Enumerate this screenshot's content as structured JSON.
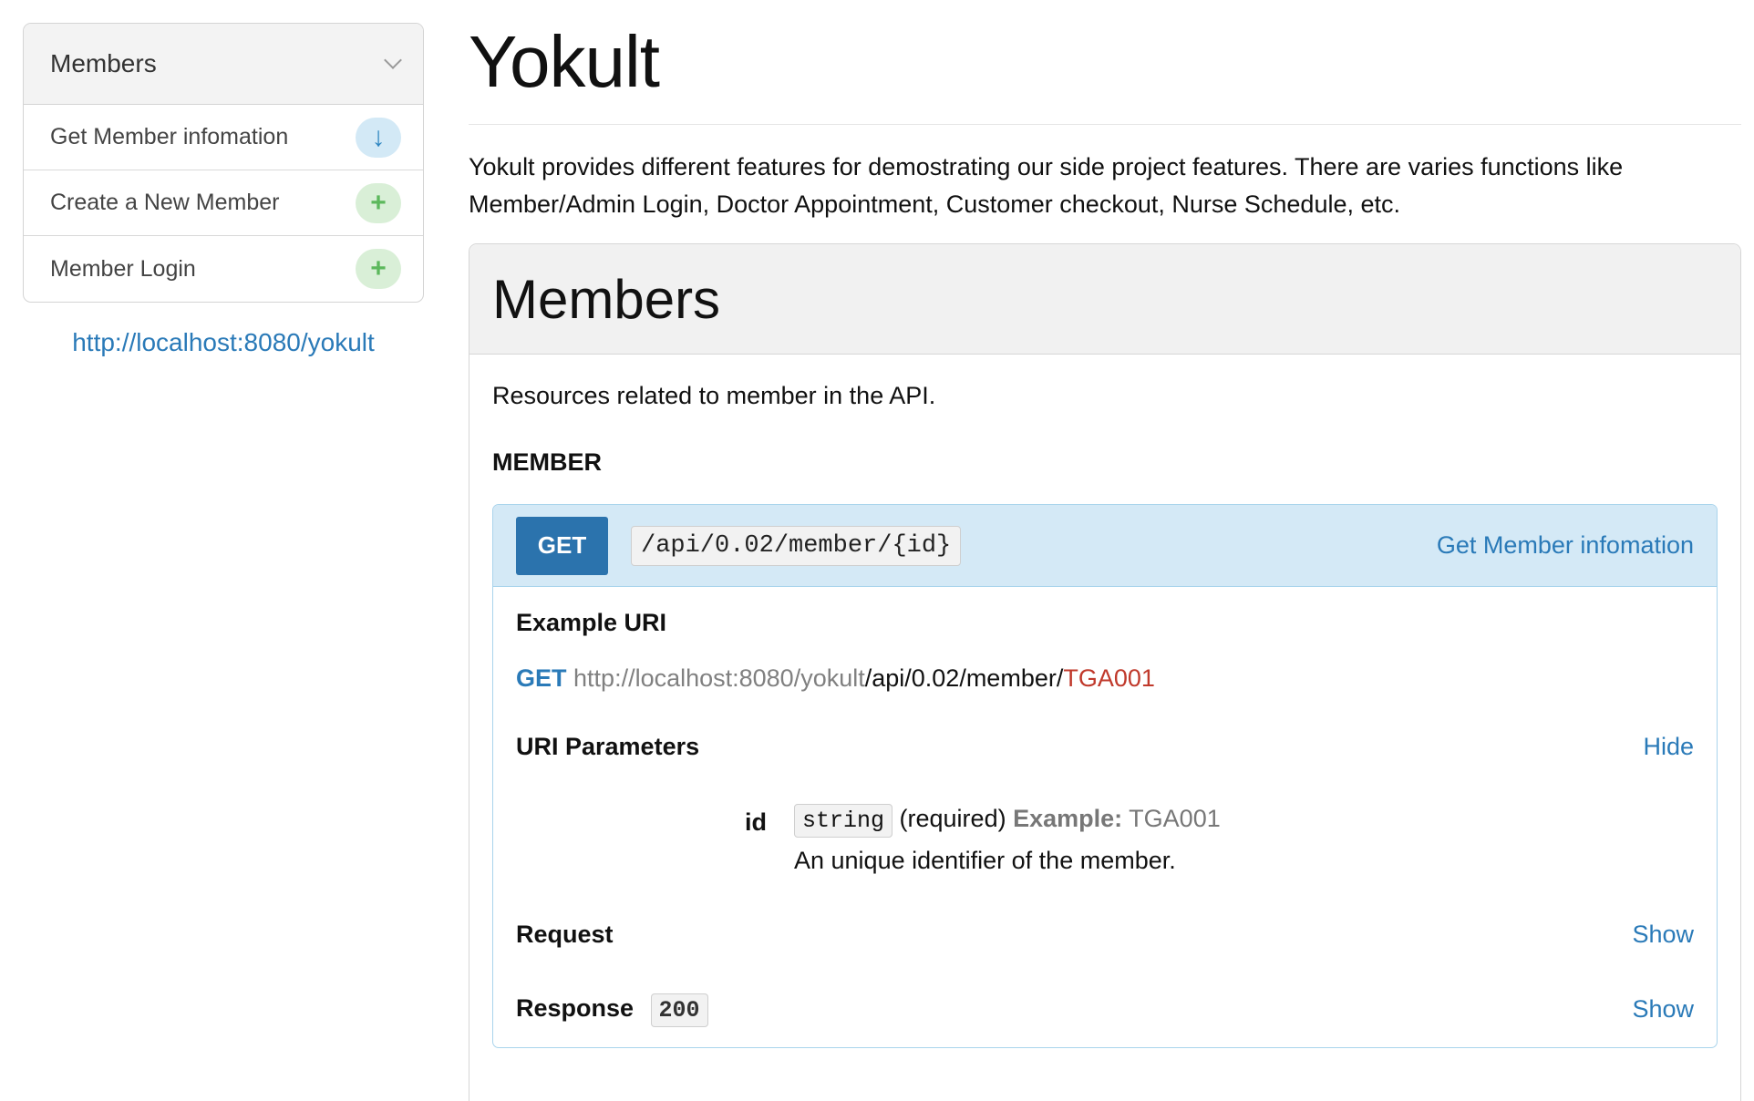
{
  "sidebar": {
    "heading": "Members",
    "items": [
      {
        "label": "Get Member infomation",
        "badge": "↓"
      },
      {
        "label": "Create a New Member",
        "badge": "+"
      },
      {
        "label": "Member Login",
        "badge": "+"
      }
    ],
    "host_link": "http://localhost:8080/yokult"
  },
  "page": {
    "title": "Yokult",
    "intro": "Yokult provides different features for demostrating our side project features. There are varies functions like Member/Admin Login, Doctor Appointment, Customer checkout, Nurse Schedule, etc."
  },
  "section": {
    "title": "Members",
    "description": "Resources related to member in the API.",
    "group_label": "MEMBER"
  },
  "resource": {
    "method": "GET",
    "uri_template": "/api/0.02/member/{id}",
    "name": "Get Member infomation",
    "example_uri_label": "Example URI",
    "example_method": "GET",
    "example_host": "http://localhost:8080/yokult",
    "example_path": "/api/0.02/member/",
    "example_param": "TGA001",
    "uri_params_label": "URI Parameters",
    "uri_params_toggle": "Hide",
    "param": {
      "name": "id",
      "type": "string",
      "required": "(required)",
      "example_label": "Example:",
      "example_value": "TGA001",
      "description": "An unique identifier of the member."
    },
    "request_label": "Request",
    "request_toggle": "Show",
    "response_label": "Response",
    "response_code": "200",
    "response_toggle": "Show"
  },
  "colors": {
    "accent": "#2a7ab8",
    "method_button": "#2b73ad",
    "resource_header": "#d4e9f6",
    "param_highlight": "#c0392b"
  }
}
